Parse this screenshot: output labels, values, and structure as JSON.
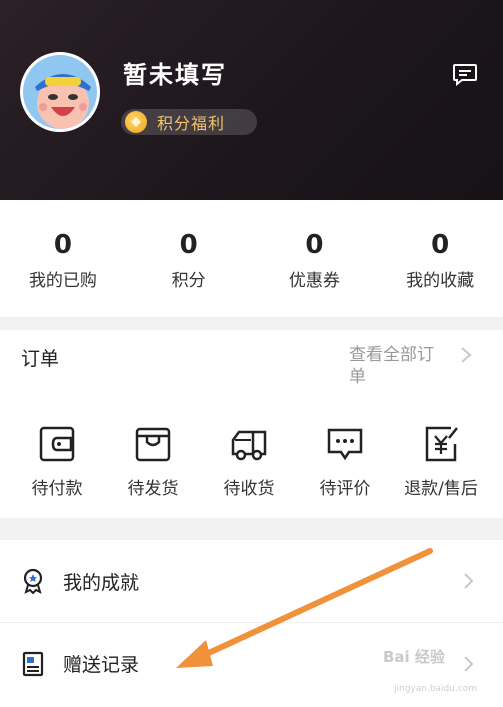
{
  "profile": {
    "username": "暂未填写",
    "points_badge": "积分福利"
  },
  "icons": {
    "message": "message-icon",
    "coin": "coin-icon",
    "chevron": "chevron-right-icon"
  },
  "stats": [
    {
      "value": "0",
      "label": "我的已购"
    },
    {
      "value": "0",
      "label": "积分"
    },
    {
      "value": "0",
      "label": "优惠券"
    },
    {
      "value": "0",
      "label": "我的收藏"
    }
  ],
  "orders": {
    "title": "订单",
    "view_all": "查看全部订单",
    "items": [
      {
        "label": "待付款",
        "icon": "wallet-icon"
      },
      {
        "label": "待发货",
        "icon": "box-icon"
      },
      {
        "label": "待收货",
        "icon": "truck-icon"
      },
      {
        "label": "待评价",
        "icon": "comment-icon"
      },
      {
        "label": "退款/售后",
        "icon": "refund-icon"
      }
    ]
  },
  "menu": [
    {
      "label": "我的成就",
      "icon": "medal-icon"
    },
    {
      "label": "赠送记录",
      "icon": "gift-record-icon"
    }
  ],
  "watermark": {
    "text": "Bai 经验",
    "sub": "jingyan.baidu.com"
  },
  "colors": {
    "header_bg": "#1d171c",
    "badge_text": "#f3c46b",
    "annotation_arrow": "#f0923a"
  }
}
